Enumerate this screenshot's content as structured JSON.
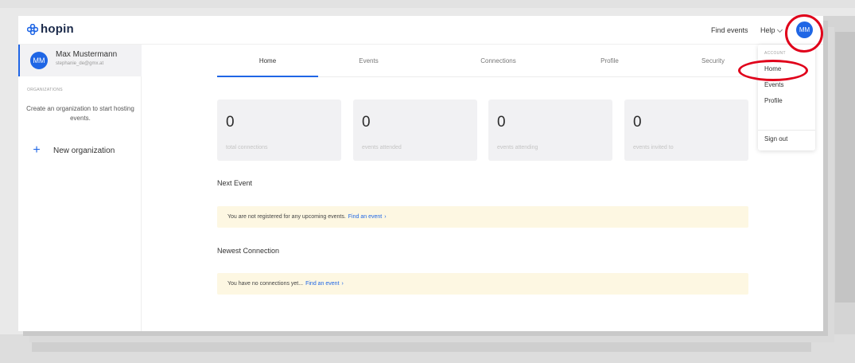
{
  "brand": {
    "name": "hopin",
    "logo_icon": "hopin-flower-icon",
    "accent": "#1f66e5"
  },
  "topnav": {
    "find_events": "Find events",
    "help": "Help",
    "avatar_initials": "MM"
  },
  "user": {
    "initials": "MM",
    "name": "Max Mustermann",
    "email": "stephanie_de@gmx.at"
  },
  "sidebar": {
    "org_heading": "ORGANIZATIONS",
    "org_help": "Create an organization to start hosting events.",
    "new_org_label": "New organization"
  },
  "tabs": [
    {
      "label": "Home",
      "active": true
    },
    {
      "label": "Events",
      "active": false
    },
    {
      "label": "Connections",
      "active": false
    },
    {
      "label": "Profile",
      "active": false
    },
    {
      "label": "Security",
      "active": false
    }
  ],
  "stats": [
    {
      "value": "0",
      "label": "total connections"
    },
    {
      "value": "0",
      "label": "events attended"
    },
    {
      "value": "0",
      "label": "events attending"
    },
    {
      "value": "0",
      "label": "events invited to"
    }
  ],
  "next_event": {
    "title": "Next Event",
    "message": "You are not registered for any upcoming events.",
    "link": "Find an event",
    "arrow": "›"
  },
  "newest_connection": {
    "title": "Newest Connection",
    "message": "You have no connections yet...",
    "link": "Find an event",
    "arrow": "›"
  },
  "dropdown": {
    "heading": "ACCOUNT",
    "items": [
      "Home",
      "Events",
      "Profile",
      "Sign out"
    ]
  },
  "colors": {
    "annotation": "#e0001a",
    "notice_bg": "#fdf7e2",
    "card_bg": "#f1f1f3"
  }
}
